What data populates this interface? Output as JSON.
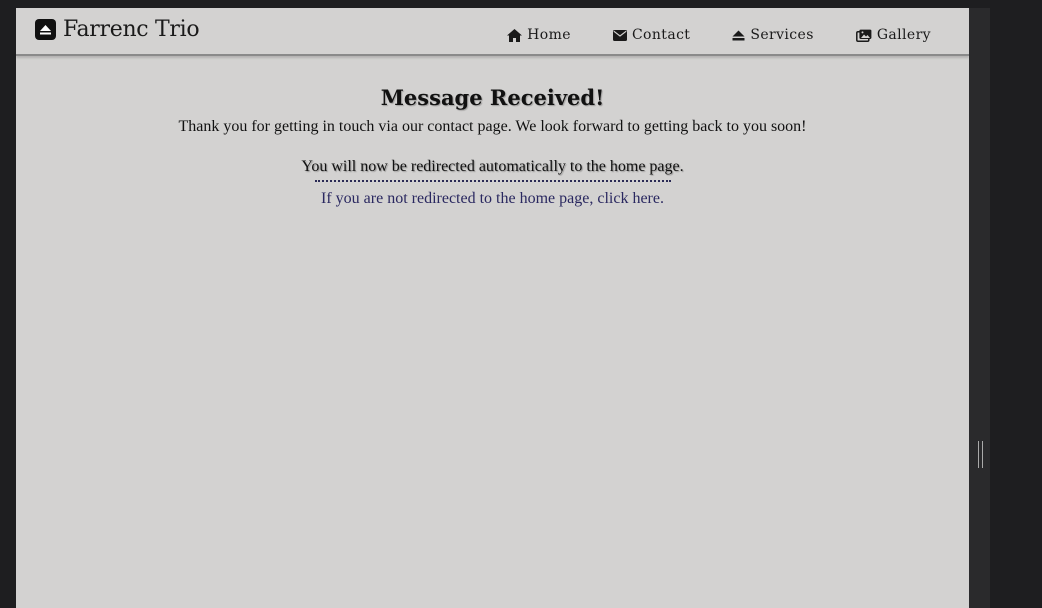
{
  "nav": {
    "brand": "Farrenc Trio",
    "links": [
      {
        "label": "Home",
        "icon": "home-icon"
      },
      {
        "label": "Contact",
        "icon": "envelope-icon"
      },
      {
        "label": "Services",
        "icon": "eject-icon"
      },
      {
        "label": "Gallery",
        "icon": "images-icon"
      }
    ]
  },
  "main": {
    "heading": "Message Received!",
    "thanks": "Thank you for getting in touch via our contact page. We look forward to getting back to you soon!",
    "redirect_notice": "You will now be redirected automatically to the home page.",
    "fallback_link": "If you are not redirected to the home page, click here."
  },
  "colors": {
    "page_bg": "#d3d2d1",
    "frame_bg": "#1e1e20",
    "link": "#2a2860"
  }
}
